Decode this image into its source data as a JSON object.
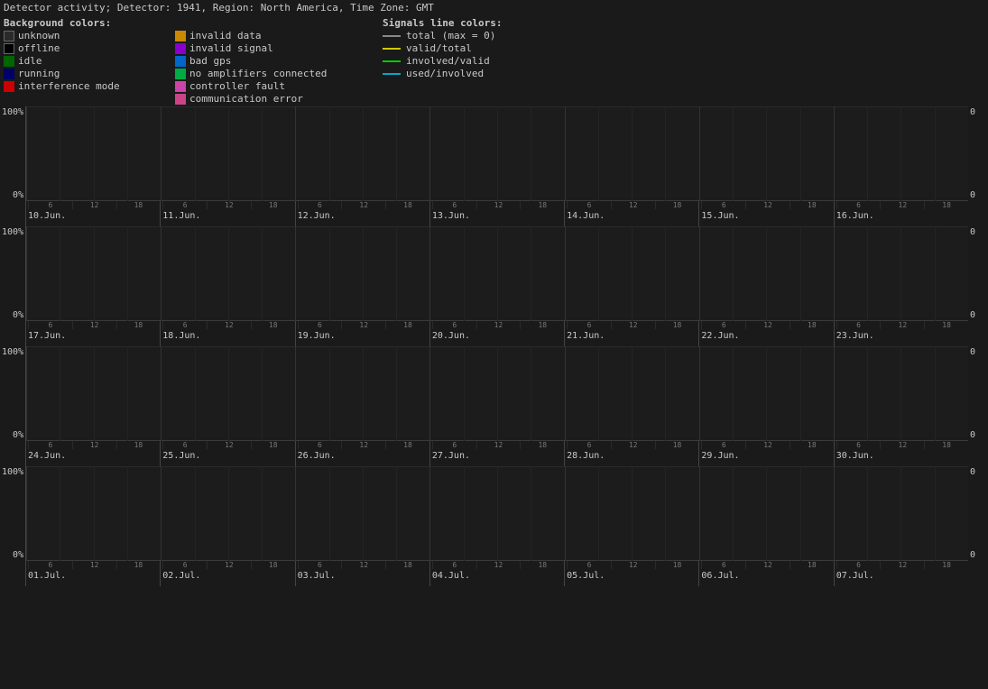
{
  "header": {
    "title": "Detector activity; Detector: 1941, Region: North America, Time Zone: GMT"
  },
  "legend": {
    "bg_title": "Background colors:",
    "bg_items": [
      {
        "label": "unknown",
        "color": "#2a2a2a",
        "border": "#666"
      },
      {
        "label": "offline",
        "color": "#000000",
        "border": "#666"
      },
      {
        "label": "idle",
        "color": "#1a3a1a",
        "border": "#1a3a1a"
      },
      {
        "label": "running",
        "color": "#1a1a3a",
        "border": "#1a1a3a"
      },
      {
        "label": "interference mode",
        "color": "#cc0000",
        "border": "#cc0000"
      }
    ],
    "mid_items": [
      {
        "label": "invalid data",
        "color": "#cc8800",
        "border": "#cc8800"
      },
      {
        "label": "invalid signal",
        "color": "#8800cc",
        "border": "#8800cc"
      },
      {
        "label": "bad gps",
        "color": "#0066cc",
        "border": "#0066cc"
      },
      {
        "label": "no amplifiers connected",
        "color": "#00aa44",
        "border": "#00aa44"
      },
      {
        "label": "controller fault",
        "color": "#cc44aa",
        "border": "#cc44aa"
      },
      {
        "label": "communication error",
        "color": "#cc4488",
        "border": "#cc4488"
      }
    ],
    "sig_title": "Signals line colors:",
    "sig_items": [
      {
        "label": "total (max = 0)",
        "color": "#888888"
      },
      {
        "label": "valid/total",
        "color": "#cccc00"
      },
      {
        "label": "involved/valid",
        "color": "#00cc00"
      },
      {
        "label": "used/involved",
        "color": "#00aacc"
      }
    ]
  },
  "charts": [
    {
      "id": "chart1",
      "dates": [
        "10.Jun.",
        "11.Jun.",
        "12.Jun.",
        "13.Jun.",
        "14.Jun.",
        "15.Jun.",
        "16.Jun."
      ]
    },
    {
      "id": "chart2",
      "dates": [
        "17.Jun.",
        "18.Jun.",
        "19.Jun.",
        "20.Jun.",
        "21.Jun.",
        "22.Jun.",
        "23.Jun."
      ]
    },
    {
      "id": "chart3",
      "dates": [
        "24.Jun.",
        "25.Jun.",
        "26.Jun.",
        "27.Jun.",
        "28.Jun.",
        "29.Jun.",
        "30.Jun."
      ]
    },
    {
      "id": "chart4",
      "dates": [
        "01.Jul.",
        "02.Jul.",
        "03.Jul.",
        "04.Jul.",
        "05.Jul.",
        "06.Jul.",
        "07.Jul."
      ]
    }
  ],
  "y_labels": {
    "top": "100%",
    "mid": "0%",
    "right_top": "0",
    "right_mid": "0"
  },
  "tick_labels": [
    "6",
    "12",
    "18"
  ]
}
